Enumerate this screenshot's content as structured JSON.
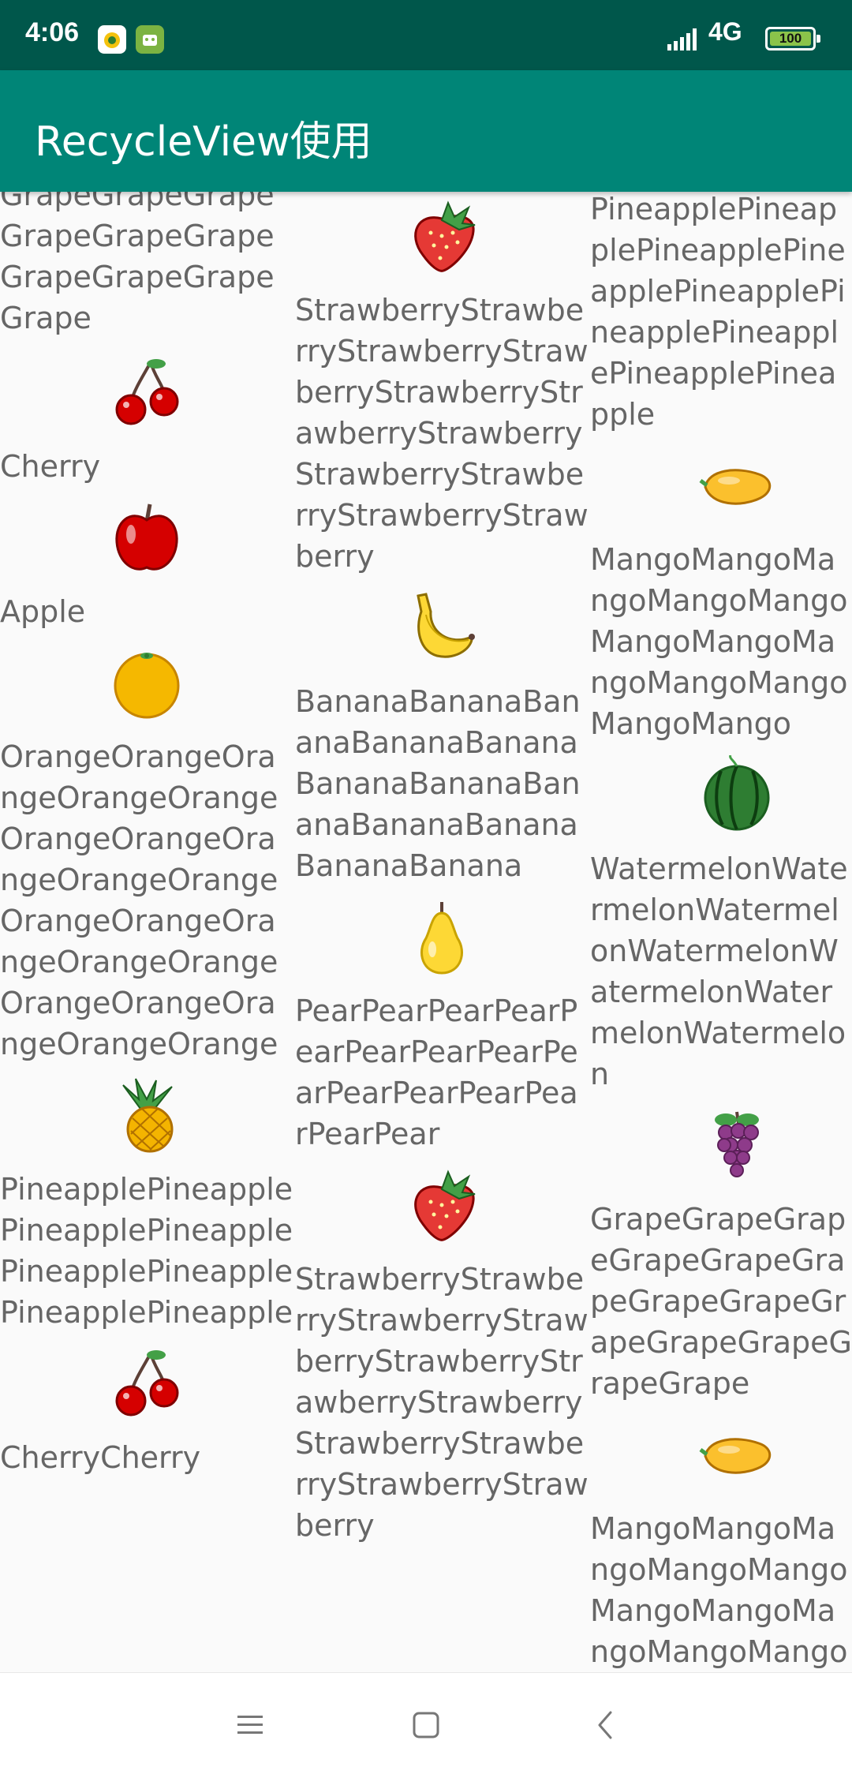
{
  "status_bar": {
    "time": "4:06",
    "network": "4G",
    "battery": "100"
  },
  "toolbar": {
    "title": "RecycleView使用",
    "color": "#008577"
  },
  "grid": {
    "col1": [
      {
        "fruit": "grape",
        "icon": "grape-icon",
        "name": "GrapeGrapeGrapeGrapeGrapeGrapeGrapeGrapeGrapeGrape"
      },
      {
        "fruit": "cherry",
        "icon": "cherry-icon",
        "name": "Cherry"
      },
      {
        "fruit": "apple",
        "icon": "apple-icon",
        "name": "Apple"
      },
      {
        "fruit": "orange",
        "icon": "orange-icon",
        "name": "OrangeOrangeOrangeOrangeOrangeOrangeOrangeOrangeOrangeOrangeOrangeOrangeOrangeOrangeOrangeOrangeOrangeOrangeOrangeOrange"
      },
      {
        "fruit": "pineapple",
        "icon": "pineapple-icon",
        "name": "PineapplePineapplePineapplePineapplePineapplePineapplePineapplePineapple"
      },
      {
        "fruit": "cherry",
        "icon": "cherry-icon",
        "name": "CherryCherry"
      }
    ],
    "col2": [
      {
        "fruit": "strawberry",
        "icon": "strawberry-icon",
        "name": "StrawberryStrawberryStrawberryStrawberryStrawberryStrawberryStrawberryStrawberryStrawberryStrawberryStrawberry"
      },
      {
        "fruit": "banana",
        "icon": "banana-icon",
        "name": "BananaBananaBananaBananaBananaBananaBananaBananaBananaBananaBananaBanana"
      },
      {
        "fruit": "pear",
        "icon": "pear-icon",
        "name": "PearPearPearPearPearPearPearPearPearPearPearPearPearPearPear"
      },
      {
        "fruit": "strawberry",
        "icon": "strawberry-icon",
        "name": "StrawberryStrawberryStrawberryStrawberryStrawberryStrawberryStrawberryStrawberryStrawberryStrawberryStrawberry"
      }
    ],
    "col3": [
      {
        "fruit": "pineapple",
        "icon": "pineapple-icon",
        "name": "PineapplePineapplePineapplePineapplePineapplePineapplePineapplePineapplePineapple"
      },
      {
        "fruit": "mango",
        "icon": "mango-icon",
        "name": "MangoMangoMangoMangoMangoMangoMangoMangoMangoMangoMangoMango"
      },
      {
        "fruit": "watermelon",
        "icon": "watermelon-icon",
        "name": "WatermelonWatermelonWatermelonWatermelonWatermelonWatermelonWatermelon"
      },
      {
        "fruit": "grape",
        "icon": "grape-icon",
        "name": "GrapeGrapeGrapeGrapeGrapeGrapeGrapeGrapeGrapeGrapeGrapeGrapeGrape"
      },
      {
        "fruit": "mango",
        "icon": "mango-icon",
        "name": "MangoMangoMangoMangoMangoMangoMangoMangoMangoMango"
      }
    ]
  },
  "nav_bar": {
    "buttons": [
      "menu-icon",
      "home-icon",
      "back-icon"
    ]
  }
}
